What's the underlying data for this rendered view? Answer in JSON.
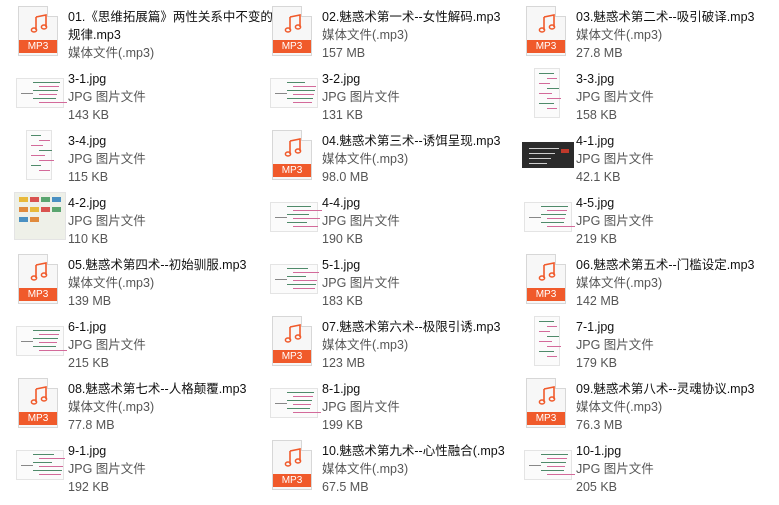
{
  "files": [
    {
      "name": "01.《思维拓展篇》两性关系中不变的规律.mp3",
      "type": "媒体文件(.mp3)",
      "size": "",
      "kind": "mp3",
      "wrap": true
    },
    {
      "name": "02.魅惑术第一术--女性解码.mp3",
      "type": "媒体文件(.mp3)",
      "size": "157 MB",
      "kind": "mp3"
    },
    {
      "name": "03.魅惑术第二术--吸引破译.mp3",
      "type": "媒体文件(.mp3)",
      "size": "27.8 MB",
      "kind": "mp3"
    },
    {
      "name": "3-1.jpg",
      "type": "JPG 图片文件",
      "size": "143 KB",
      "kind": "jpg-wide"
    },
    {
      "name": "3-2.jpg",
      "type": "JPG 图片文件",
      "size": "131 KB",
      "kind": "jpg-wide"
    },
    {
      "name": "3-3.jpg",
      "type": "JPG 图片文件",
      "size": "158 KB",
      "kind": "jpg-tall"
    },
    {
      "name": "3-4.jpg",
      "type": "JPG 图片文件",
      "size": "115 KB",
      "kind": "jpg-tall"
    },
    {
      "name": "04.魅惑术第三术--诱饵呈现.mp3",
      "type": "媒体文件(.mp3)",
      "size": "98.0 MB",
      "kind": "mp3"
    },
    {
      "name": "4-1.jpg",
      "type": "JPG 图片文件",
      "size": "42.1 KB",
      "kind": "jpg-dark"
    },
    {
      "name": "4-2.jpg",
      "type": "JPG 图片文件",
      "size": "110 KB",
      "kind": "jpg-busy"
    },
    {
      "name": "4-4.jpg",
      "type": "JPG 图片文件",
      "size": "190 KB",
      "kind": "jpg-wide"
    },
    {
      "name": "4-5.jpg",
      "type": "JPG 图片文件",
      "size": "219 KB",
      "kind": "jpg-wide"
    },
    {
      "name": "05.魅惑术第四术--初始驯服.mp3",
      "type": "媒体文件(.mp3)",
      "size": "139 MB",
      "kind": "mp3"
    },
    {
      "name": "5-1.jpg",
      "type": "JPG 图片文件",
      "size": "183 KB",
      "kind": "jpg-wide"
    },
    {
      "name": "06.魅惑术第五术--门槛设定.mp3",
      "type": "媒体文件(.mp3)",
      "size": "142 MB",
      "kind": "mp3"
    },
    {
      "name": "6-1.jpg",
      "type": "JPG 图片文件",
      "size": "215 KB",
      "kind": "jpg-wide"
    },
    {
      "name": "07.魅惑术第六术--极限引诱.mp3",
      "type": "媒体文件(.mp3)",
      "size": "123 MB",
      "kind": "mp3"
    },
    {
      "name": "7-1.jpg",
      "type": "JPG 图片文件",
      "size": "179 KB",
      "kind": "jpg-tall"
    },
    {
      "name": "08.魅惑术第七术--人格颠覆.mp3",
      "type": "媒体文件(.mp3)",
      "size": "77.8 MB",
      "kind": "mp3"
    },
    {
      "name": "8-1.jpg",
      "type": "JPG 图片文件",
      "size": "199 KB",
      "kind": "jpg-wide"
    },
    {
      "name": "09.魅惑术第八术--灵魂协议.mp3",
      "type": "媒体文件(.mp3)",
      "size": "76.3 MB",
      "kind": "mp3"
    },
    {
      "name": "9-1.jpg",
      "type": "JPG 图片文件",
      "size": "192 KB",
      "kind": "jpg-wide"
    },
    {
      "name": "10.魅惑术第九术--心性融合(.mp3",
      "type": "媒体文件(.mp3)",
      "size": "67.5 MB",
      "kind": "mp3"
    },
    {
      "name": "10-1.jpg",
      "type": "JPG 图片文件",
      "size": "205 KB",
      "kind": "jpg-wide"
    }
  ],
  "icons": {
    "mp3_badge": "MP3",
    "audio": "music-note-icon",
    "image": "mindmap-thumbnail"
  },
  "colors": {
    "mp3_accent": "#f05a2b",
    "mindmap_line": "#d36a9a",
    "mindmap_branch": "#4f8a6a"
  }
}
